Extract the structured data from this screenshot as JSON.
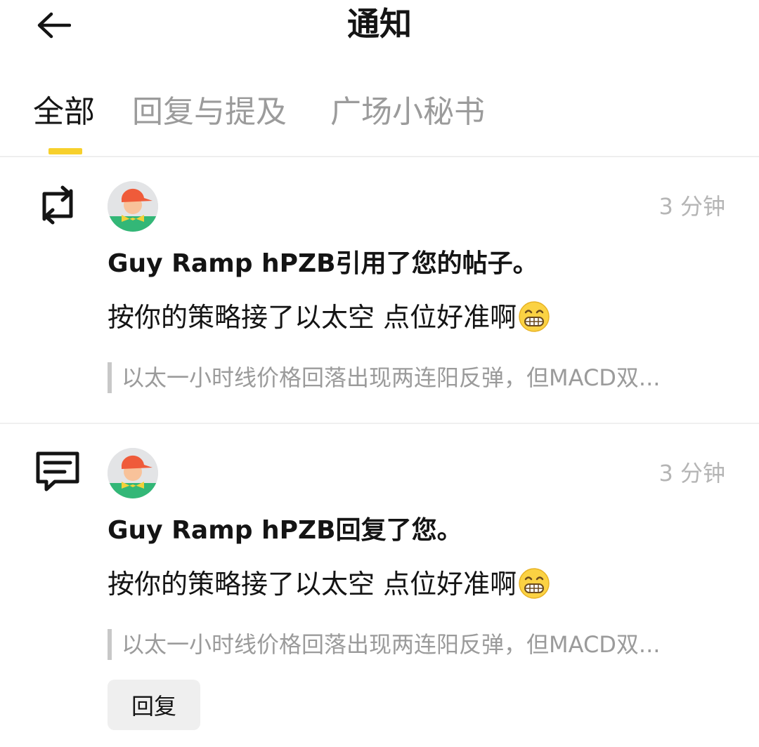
{
  "header": {
    "title": "通知",
    "back_icon": "arrow-left-icon"
  },
  "tabs": [
    {
      "label": "全部",
      "active": true
    },
    {
      "label": "回复与提及",
      "active": false
    },
    {
      "label": "广场小秘书",
      "active": false
    }
  ],
  "accent_color": "#f7d02c",
  "notifications": [
    {
      "type_icon": "repost-icon",
      "time": "3 分钟",
      "headline": "Guy Ramp hPZB引用了您的帖子。",
      "body": "按你的策略接了以太空 点位好准啊",
      "body_emoji": "grinning-face-icon",
      "quote": "以太一小时线价格回落出现两连阳反弹，但MACD双..."
    },
    {
      "type_icon": "comment-icon",
      "time": "3 分钟",
      "headline": "Guy Ramp hPZB回复了您。",
      "body": "按你的策略接了以太空 点位好准啊",
      "body_emoji": "grinning-face-icon",
      "quote": "以太一小时线价格回落出现两连阳反弹，但MACD双...",
      "reply_label": "回复"
    }
  ]
}
